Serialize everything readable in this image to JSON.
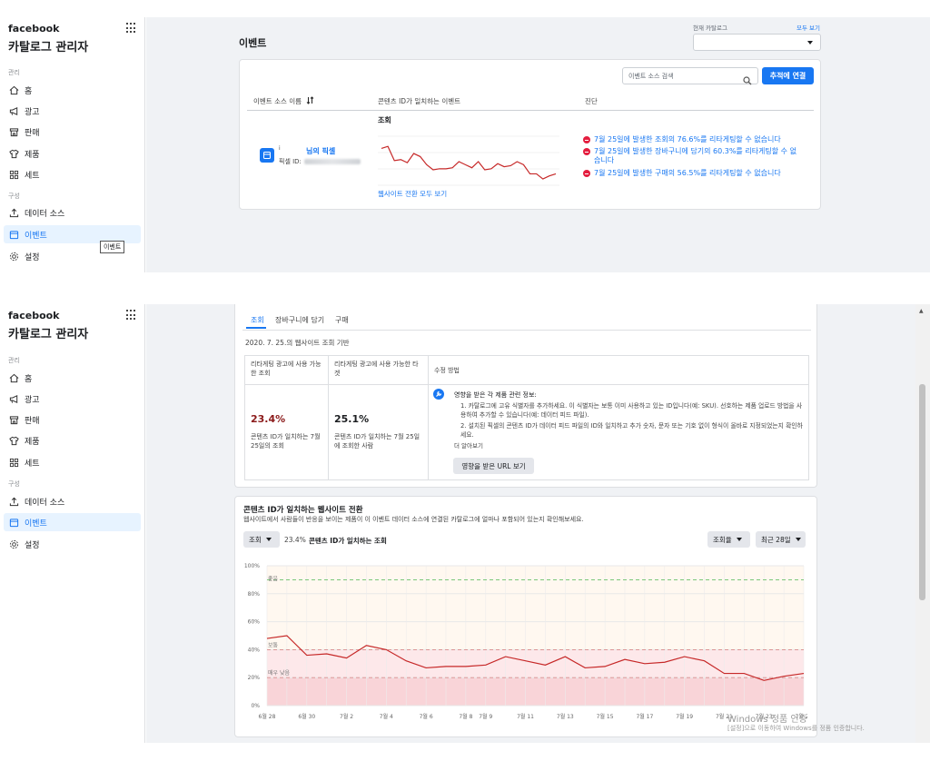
{
  "sidebar": {
    "logo": "facebook",
    "title": "카탈로그 관리자",
    "section_manage": "관리",
    "section_config": "구성",
    "items": [
      {
        "label": "홈",
        "icon": "home-icon"
      },
      {
        "label": "광고",
        "icon": "megaphone-icon"
      },
      {
        "label": "판매",
        "icon": "shop-icon"
      },
      {
        "label": "제품",
        "icon": "tshirt-icon"
      },
      {
        "label": "세트",
        "icon": "grid-set-icon"
      },
      {
        "label": "데이터 소스",
        "icon": "upload-icon"
      },
      {
        "label": "이벤트",
        "icon": "calendar-icon"
      },
      {
        "label": "설정",
        "icon": "gear-icon"
      }
    ],
    "tooltip": "이벤트"
  },
  "top": {
    "page_title": "이벤트",
    "catalog_label": "현재 카탈로그",
    "view_all": "모두 보기",
    "search_placeholder": "이벤트 소스 검색",
    "connect_button": "추적에 연결",
    "col_source": "이벤트 소스 이름",
    "col_matched": "콘텐츠 ID가 일치하는 이벤트",
    "col_diag": "진단",
    "event_label": "조회",
    "source_name_prefix": "i",
    "source_name": "님의 픽셀",
    "pixel_id_label": "픽셀 ID:",
    "see_all_link": "웹사이트 전환 모두 보기",
    "diagnostics": [
      "7월 25일에 발생한 조회의 76.6%를 리타게팅할 수 없습니다",
      "7월 25일에 발생한 장바구니에 담기의 60.3%를 리타게팅할 수 없습니다",
      "7월 25일에 발생한 구매의 56.5%를 리타게팅할 수 없습니다"
    ]
  },
  "detail": {
    "tabs": [
      "조회",
      "장바구니에 담기",
      "구매"
    ],
    "based_on": "2020. 7. 25.의 웹사이트 조회 기반",
    "table_head": [
      "리타게팅 광고에 사용 가능한 조회",
      "리타게팅 광고에 사용 가능한 타겟",
      "수정 방법"
    ],
    "pct1": "23.4%",
    "pct1_desc": "콘텐츠 ID가 일치하는 7월 25일의 조회",
    "pct2": "25.1%",
    "pct2_desc": "콘텐츠 ID가 일치하는 7월 25일에 조회한 사람",
    "fix_title": "영향을 받은 각 제품 관련 정보:",
    "fix_1": "1. 카탈로그에 고유 식별자를 추가하세요. 이 식별자는 보통 이미 사용하고 있는 ID입니다(예: SKU). 선호하는 제품 업로드 방법을 사용하여 추가할 수 있습니다(예: 데이터 피드 파일).",
    "fix_2": "2. 설치된 픽셀의 콘텐츠 ID가 데이터 피드 파일의 ID와 일치하고 추가 숫자, 문자 또는 기호 없이 형식이 올바로 지정되었는지 확인하세요.",
    "learn_more": "더 알아보기",
    "urls_button": "영향을 받은 URL 보기"
  },
  "conv": {
    "title": "콘텐츠 ID가 일치하는 웹사이트 전환",
    "desc": "웹사이트에서 사람들이 반응을 보이는 제품이 이 이벤트 데이터 소스에 연결된 카탈로그에 얼마나 포함되어 있는지 확인해보세요.",
    "event_dd": "조회",
    "pct": "23.4%",
    "pct_label": "콘텐츠 ID가 일치하는 조회",
    "metric_dd": "조회율",
    "range_dd": "최근 28일"
  },
  "chart_data": [
    {
      "type": "line",
      "title": "조회",
      "x": [
        "6월 28",
        "6월 29",
        "6월 30",
        "7월 1",
        "7월 2",
        "7월 3",
        "7월 4",
        "7월 5",
        "7월 6",
        "7월 7",
        "7월 8",
        "7월 9",
        "7월 10",
        "7월 11",
        "7월 12",
        "7월 13",
        "7월 14",
        "7월 15",
        "7월 16",
        "7월 17",
        "7월 18",
        "7월 19",
        "7월 20",
        "7월 21",
        "7월 22",
        "7월 23",
        "7월 24",
        "7월 25"
      ],
      "series": [
        {
          "values": [
            48,
            50,
            36,
            37,
            34,
            43,
            40,
            32,
            27,
            28,
            28,
            29,
            35,
            32,
            29,
            35,
            27,
            28,
            33,
            30,
            31,
            35,
            32,
            23,
            23,
            18,
            21,
            23
          ]
        }
      ]
    },
    {
      "type": "line",
      "x": [
        "6월 28",
        "6월 29",
        "6월 30",
        "7월 1",
        "7월 2",
        "7월 3",
        "7월 4",
        "7월 5",
        "7월 6",
        "7월 7",
        "7월 8",
        "7월 9",
        "7월 10",
        "7월 11",
        "7월 12",
        "7월 13",
        "7월 14",
        "7월 15",
        "7월 16",
        "7월 17",
        "7월 18",
        "7월 19",
        "7월 20",
        "7월 21",
        "7월 22",
        "7월 23",
        "7월 24",
        "7월 25"
      ],
      "x_tick_labels": [
        "6월 28",
        "6월 30",
        "7월 2",
        "7월 4",
        "7월 6",
        "7월 8",
        "7월 9",
        "7월 11",
        "7월 13",
        "7월 15",
        "7월 17",
        "7월 19",
        "7월 21",
        "7월 23",
        "7월 25"
      ],
      "y_tick_labels": [
        "100%",
        "80%",
        "60%",
        "40%",
        "20%",
        "0%"
      ],
      "ylim": [
        0,
        100
      ],
      "bands": [
        {
          "label": "좋음",
          "threshold": 90,
          "color": "#4caf50"
        },
        {
          "label": "보통",
          "threshold": 40,
          "color": "#e57373"
        },
        {
          "label": "매우 낮음",
          "threshold": 20,
          "color": "#e57373"
        }
      ],
      "series": [
        {
          "values": [
            48,
            50,
            36,
            37,
            34,
            43,
            40,
            32,
            27,
            28,
            28,
            29,
            35,
            32,
            29,
            35,
            27,
            28,
            33,
            30,
            31,
            35,
            32,
            23,
            23,
            18,
            21,
            23
          ],
          "color": "#c62828"
        }
      ]
    }
  ],
  "watermark": {
    "line1": "Windows 정품 인증",
    "line2": "[설정]으로 이동하여 Windows를 정품 인증합니다."
  },
  "colors": {
    "accent": "#1877f2",
    "error": "#e41e3f",
    "series": "#c62828"
  }
}
